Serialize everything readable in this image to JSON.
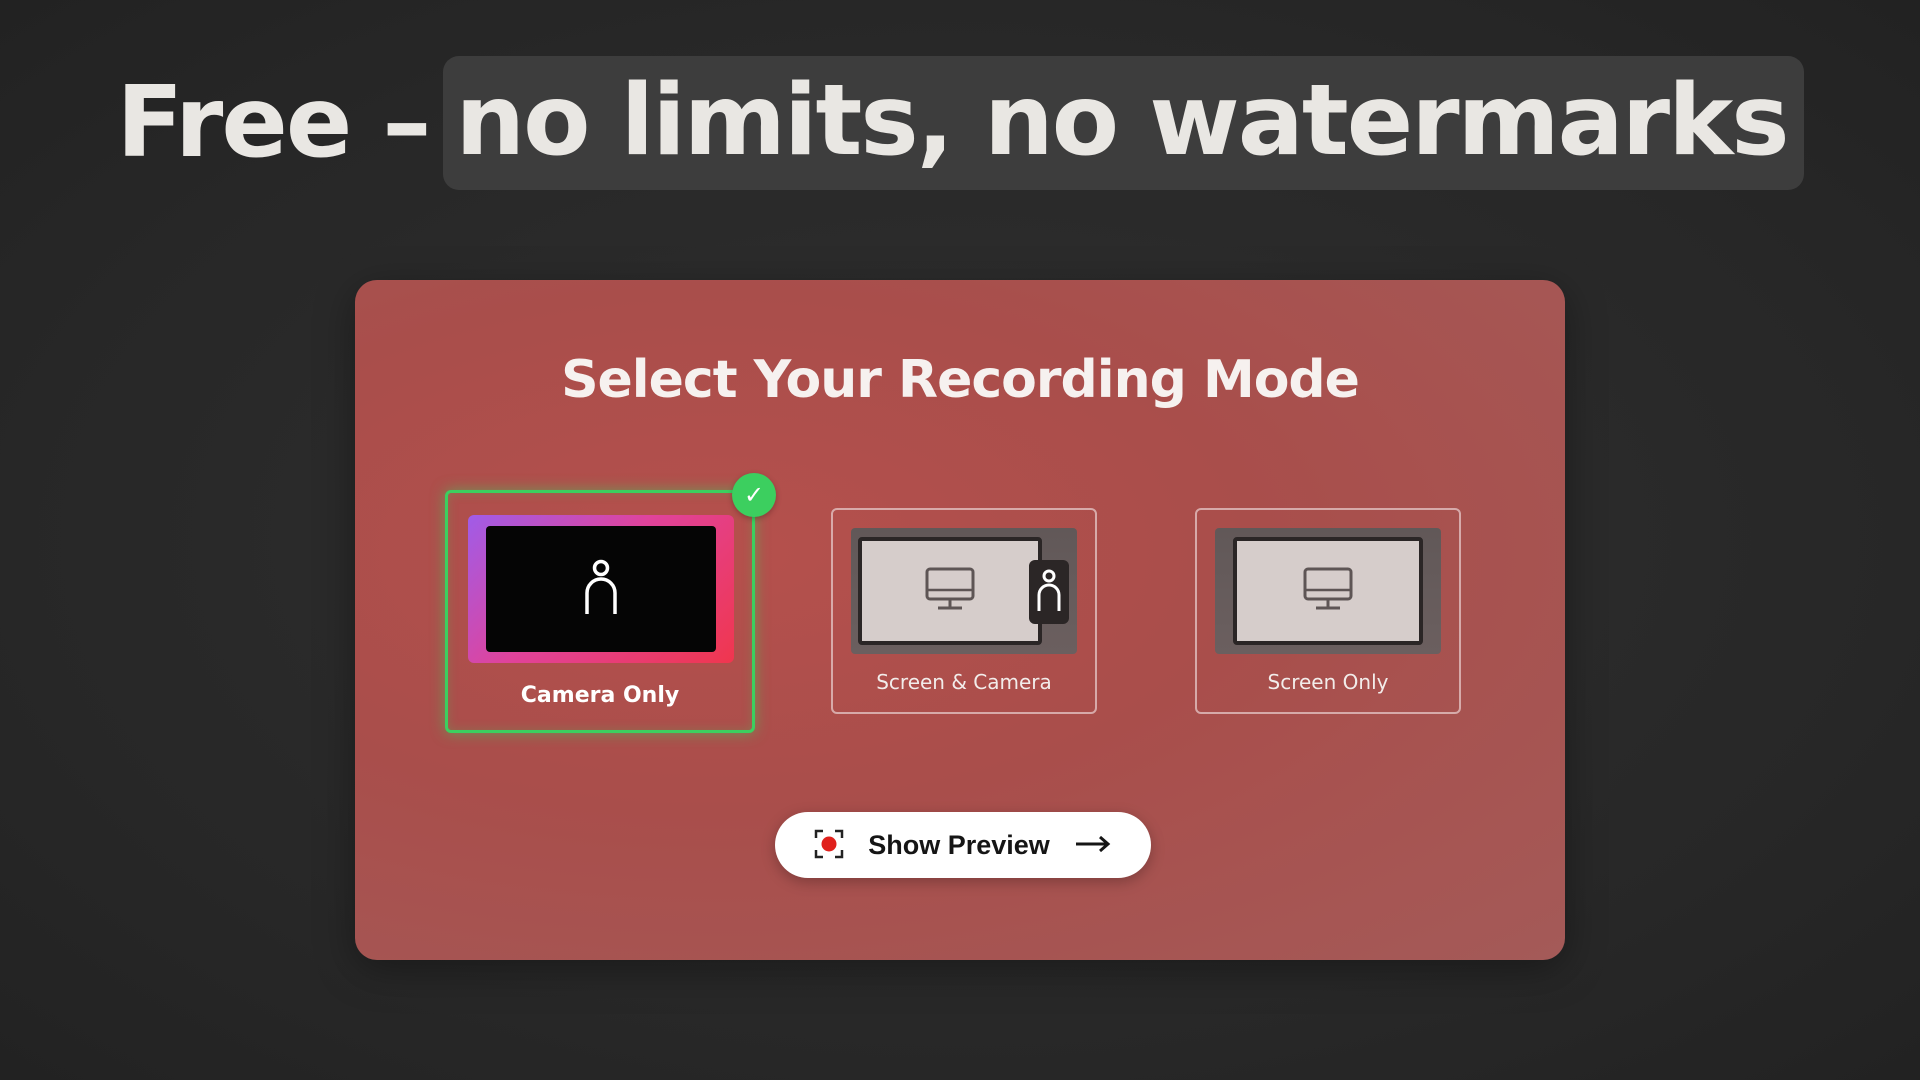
{
  "headline": {
    "lead": "Free –",
    "highlight": "no limits, no watermarks"
  },
  "panel": {
    "title": "Select Your Recording Mode",
    "options": [
      {
        "label": "Camera Only",
        "icon": "person-icon",
        "selected": true
      },
      {
        "label": "Screen & Camera",
        "icon": "monitor-person-icon",
        "selected": false
      },
      {
        "label": "Screen Only",
        "icon": "monitor-icon",
        "selected": false
      }
    ],
    "preview_button": {
      "label": "Show Preview",
      "icon": "record-icon",
      "arrow_icon": "arrow-right-icon"
    }
  },
  "colors": {
    "background": "#2a2a2a",
    "panel": "#ab4f4c",
    "selected_accent": "#3ccf5f",
    "record": "#e0201c"
  }
}
